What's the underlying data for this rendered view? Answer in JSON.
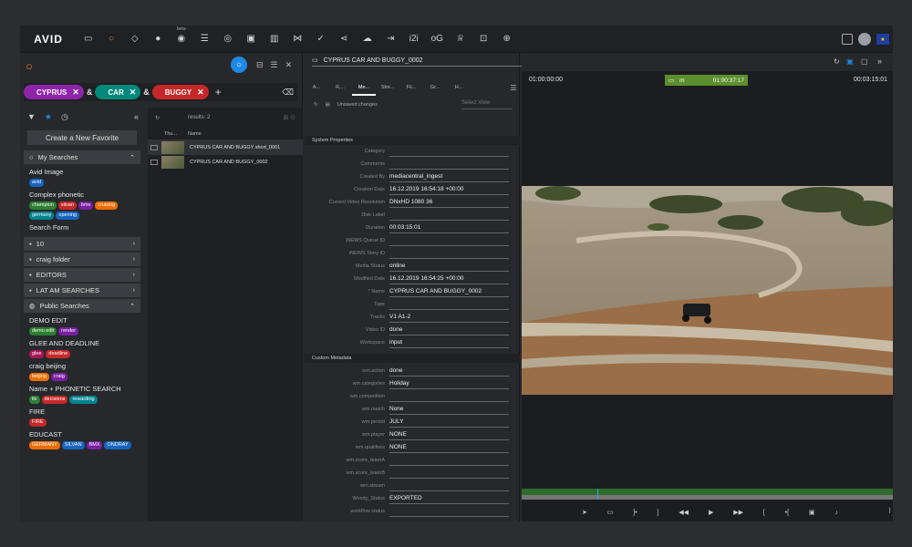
{
  "toolbar": {
    "logo": "AVID",
    "beta": "beta",
    "icons": [
      "folder-icon",
      "search-icon",
      "bins-icon",
      "user-icon",
      "chat-icon",
      "sequence-icon",
      "browse-icon",
      "monitor-icon",
      "storyboard-icon",
      "connect-icon",
      "check-icon",
      "share-icon",
      "cloud-icon",
      "export-icon",
      "i2i",
      "oG",
      "trophy-icon",
      "playlist-icon",
      "zoom-icon"
    ],
    "i2i": "i2i",
    "og": "oG"
  },
  "search": {
    "chips": [
      {
        "label": "CYPRUS",
        "color": "#8e24aa"
      },
      {
        "label": "CAR",
        "color": "#00897b"
      },
      {
        "label": "BUGGY",
        "color": "#c62828"
      }
    ],
    "amp": "&"
  },
  "favorites": {
    "create_label": "Create a New Favorite",
    "my_searches_label": "My Searches",
    "public_searches_label": "Public Searches",
    "my_items": [
      {
        "title": "Avid Image",
        "tags": [
          {
            "t": "avid",
            "c": "#1565c0"
          }
        ]
      },
      {
        "title": "Complex phonetic",
        "tags": [
          {
            "t": "champion",
            "c": "#2e7d32"
          },
          {
            "t": "silvan",
            "c": "#c62828"
          },
          {
            "t": "bmx",
            "c": "#7b1fa2"
          },
          {
            "t": "cruising",
            "c": "#ef6c00"
          },
          {
            "t": "germany",
            "c": "#00838f"
          },
          {
            "t": "opening",
            "c": "#1565c0"
          }
        ]
      },
      {
        "title": "Search Form",
        "tags": []
      }
    ],
    "folders": [
      "10",
      "craig folder",
      "EDITORS",
      "LAT AM SEARCHES"
    ],
    "public_items": [
      {
        "title": "DEMO EDIT",
        "tags": [
          {
            "t": "demo edit",
            "c": "#2e7d32"
          },
          {
            "t": "render",
            "c": "#7b1fa2"
          }
        ]
      },
      {
        "title": "GLEE AND DEADLINE",
        "tags": [
          {
            "t": "glee",
            "c": "#ad1457"
          },
          {
            "t": "deadline",
            "c": "#c62828"
          }
        ]
      },
      {
        "title": "craig beijing",
        "tags": [
          {
            "t": "beijing",
            "c": "#ef6c00"
          },
          {
            "t": "craig",
            "c": "#7b1fa2"
          }
        ]
      },
      {
        "title": "Name + PHONETIC SEARCH",
        "tags": [
          {
            "t": "itv",
            "c": "#2e7d32"
          },
          {
            "t": "decisions",
            "c": "#c62828"
          },
          {
            "t": "rewarding",
            "c": "#00838f"
          }
        ]
      },
      {
        "title": "FIRE",
        "tags": [
          {
            "t": "FIRE",
            "c": "#c62828"
          }
        ]
      },
      {
        "title": "EDUCAST",
        "tags": [
          {
            "t": "GERMANY",
            "c": "#ef6c00"
          },
          {
            "t": "SILVAN",
            "c": "#1565c0"
          },
          {
            "t": "BMX",
            "c": "#7b1fa2"
          },
          {
            "t": "ONDRAY",
            "c": "#1565c0"
          }
        ]
      }
    ]
  },
  "results": {
    "count_label": "results: 2",
    "col_thumb": "Thu...",
    "col_name": "Name",
    "rows": [
      "CYPRUS CAR AND BUGGY short_0001",
      "CYPRUS CAR AND BUGGY_0002"
    ]
  },
  "metadata": {
    "asset_title": "CYPRUS CAR AND BUGGY_0002",
    "tabs": [
      "A...",
      "R,...",
      "Me...",
      "Stor...",
      "Fil...",
      "Gr...",
      "H..."
    ],
    "active_tab": 2,
    "unsaved": "Unsaved changes",
    "select_view": "Select View",
    "system_section": "System Properties",
    "system_rows": [
      {
        "label": "Category",
        "value": ""
      },
      {
        "label": "Comments",
        "value": ""
      },
      {
        "label": "Created By",
        "value": "mediacentral_ingest"
      },
      {
        "label": "Creation Date",
        "value": "16.12.2019 16:54:18 +00:00"
      },
      {
        "label": "Current Video Resolution",
        "value": "DNxHD 1080 36"
      },
      {
        "label": "Disk Label",
        "value": ""
      },
      {
        "label": "Duration",
        "value": "00:03:15:01"
      },
      {
        "label": "iNEWS Queue ID",
        "value": ""
      },
      {
        "label": "iNEWS Story ID",
        "value": ""
      },
      {
        "label": "Media Status",
        "value": "online"
      },
      {
        "label": "Modified Date",
        "value": "16.12.2019 16:54:25 +00:00"
      },
      {
        "label": "* Name",
        "value": "CYPRUS CAR AND BUGGY_0002"
      },
      {
        "label": "Tape",
        "value": ""
      },
      {
        "label": "Tracks",
        "value": "V1 A1-2"
      },
      {
        "label": "Video ID",
        "value": "done"
      },
      {
        "label": "Workspace",
        "value": "input"
      }
    ],
    "custom_section": "Custom Metadata",
    "custom_rows": [
      {
        "label": "wm.action",
        "value": "done"
      },
      {
        "label": "wm.categories",
        "value": "Holiday"
      },
      {
        "label": "wm.competition",
        "value": ""
      },
      {
        "label": "wm.match",
        "value": "None"
      },
      {
        "label": "wm.period",
        "value": "JULY"
      },
      {
        "label": "wm.player",
        "value": "NONE"
      },
      {
        "label": "wm.qualifiers",
        "value": "NONE"
      },
      {
        "label": "wm.score_teamA",
        "value": ""
      },
      {
        "label": "wm.score_teamB",
        "value": ""
      },
      {
        "label": "wm.stream",
        "value": ""
      },
      {
        "label": "Woody_Status",
        "value": "EXPORTED"
      },
      {
        "label": "workflow status",
        "value": ""
      }
    ]
  },
  "viewer": {
    "tc_in": "01:00:00:00",
    "tc_mode": "m",
    "tc_duration": "01:00:37:17",
    "tc_out": "00:03:15:01"
  }
}
